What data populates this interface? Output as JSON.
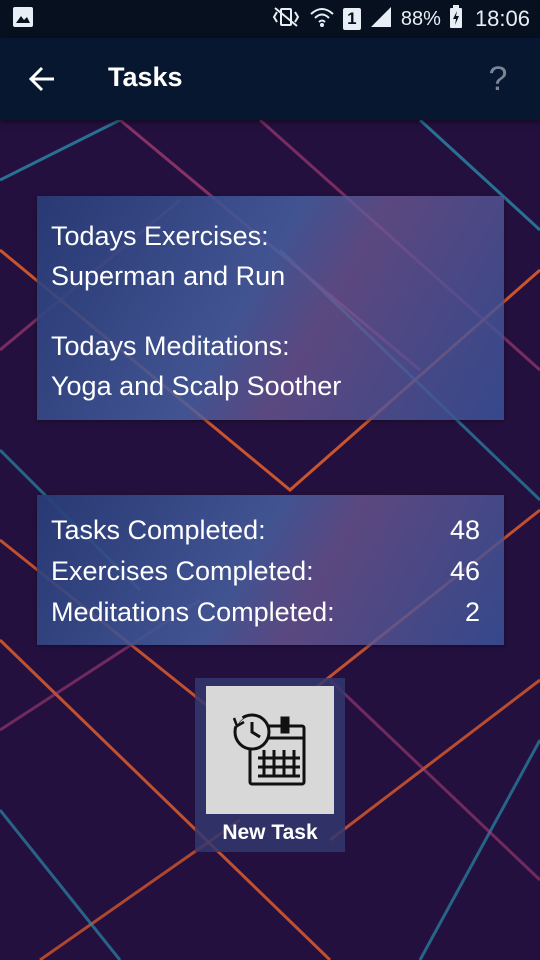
{
  "status_bar": {
    "battery": "88%",
    "time": "18:06",
    "sim_slot": "1",
    "icons": [
      "image-notification-icon",
      "vibrate-icon",
      "wifi-icon",
      "sim-icon",
      "signal-icon",
      "battery-charging-icon"
    ]
  },
  "app_bar": {
    "title": "Tasks",
    "back_icon": "arrow-left-icon",
    "help_label": "?"
  },
  "today": {
    "exercises_label": "Todays Exercises:",
    "exercises_value": "Superman and Run",
    "meditations_label": "Todays Meditations:",
    "meditations_value": "Yoga and Scalp Soother"
  },
  "stats": {
    "rows": [
      {
        "label": "Tasks Completed:",
        "value": "48"
      },
      {
        "label": "Exercises Completed:",
        "value": "46"
      },
      {
        "label": "Meditations Completed:",
        "value": "2"
      }
    ]
  },
  "new_task": {
    "label": "New Task",
    "icon": "schedule-calendar-icon"
  },
  "colors": {
    "background": "#24103e",
    "app_bar": "#081730",
    "status_bar": "#06101f",
    "line_orange": "#e8602a",
    "line_teal": "#2a8aa8",
    "line_magenta": "#b0407a"
  }
}
